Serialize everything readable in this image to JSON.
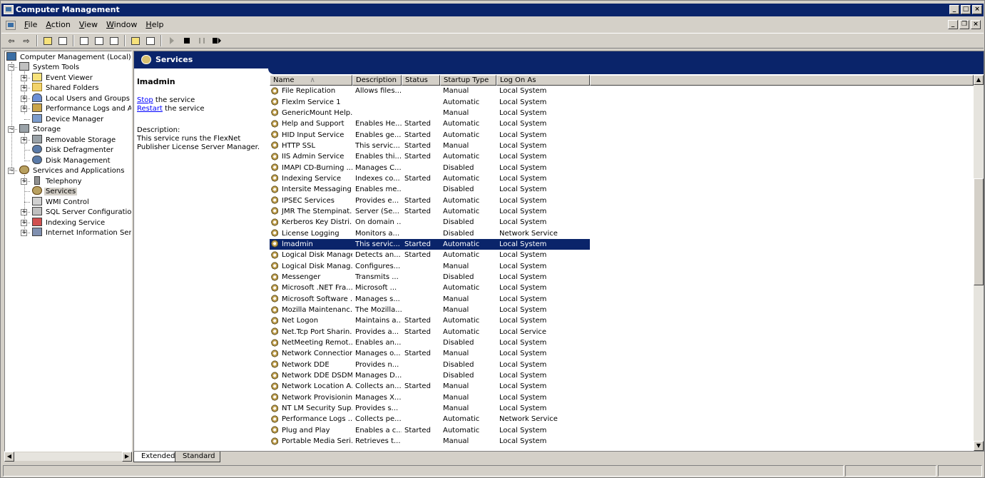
{
  "window": {
    "title": "Computer Management",
    "controls": [
      "_",
      "□",
      "×"
    ]
  },
  "menu": {
    "items": [
      {
        "label": "File",
        "key": "F",
        "rest": "ile"
      },
      {
        "label": "Action",
        "key": "A",
        "rest": "ction"
      },
      {
        "label": "View",
        "key": "V",
        "rest": "iew"
      },
      {
        "label": "Window",
        "key": "W",
        "rest": "indow"
      },
      {
        "label": "Help",
        "key": "H",
        "rest": "elp"
      }
    ],
    "mdi_controls": [
      "_",
      "❐",
      "×"
    ]
  },
  "toolbar": {
    "buttons": [
      "back-icon",
      "forward-icon",
      "up-folder-icon",
      "show-hide-tree-icon",
      "properties-icon",
      "refresh-icon",
      "export-list-icon",
      "help-icon",
      "show-hide-action-pane-icon",
      "start-service-icon",
      "stop-service-icon",
      "pause-service-icon",
      "restart-service-icon"
    ]
  },
  "tree": {
    "root": "Computer Management (Local)",
    "nodes": [
      {
        "label": "System Tools",
        "level": 1,
        "expander": "−",
        "icon": "tools"
      },
      {
        "label": "Event Viewer",
        "level": 2,
        "expander": "+",
        "icon": "event"
      },
      {
        "label": "Shared Folders",
        "level": 2,
        "expander": "+",
        "icon": "folder"
      },
      {
        "label": "Local Users and Groups",
        "level": 2,
        "expander": "+",
        "icon": "users"
      },
      {
        "label": "Performance Logs and Alerts",
        "level": 2,
        "expander": "+",
        "icon": "perf"
      },
      {
        "label": "Device Manager",
        "level": 2,
        "expander": "",
        "icon": "device"
      },
      {
        "label": "Storage",
        "level": 1,
        "expander": "−",
        "icon": "storage"
      },
      {
        "label": "Removable Storage",
        "level": 2,
        "expander": "+",
        "icon": "storage"
      },
      {
        "label": "Disk Defragmenter",
        "level": 2,
        "expander": "",
        "icon": "disk"
      },
      {
        "label": "Disk Management",
        "level": 2,
        "expander": "",
        "icon": "disk"
      },
      {
        "label": "Services and Applications",
        "level": 1,
        "expander": "−",
        "icon": "services"
      },
      {
        "label": "Telephony",
        "level": 2,
        "expander": "+",
        "icon": "phone"
      },
      {
        "label": "Services",
        "level": 2,
        "expander": "",
        "icon": "services",
        "selected": true
      },
      {
        "label": "WMI Control",
        "level": 2,
        "expander": "",
        "icon": "wmi"
      },
      {
        "label": "SQL Server Configuration Manager",
        "level": 2,
        "expander": "+",
        "icon": "sql"
      },
      {
        "label": "Indexing Service",
        "level": 2,
        "expander": "+",
        "icon": "index"
      },
      {
        "label": "Internet Information Services",
        "level": 2,
        "expander": "+",
        "icon": "iis"
      }
    ]
  },
  "pane": {
    "header": "Services",
    "selected_name": "lmadmin",
    "stop_link": "Stop",
    "stop_rest": " the service",
    "restart_link": "Restart",
    "restart_rest": " the service",
    "description_label": "Description:",
    "description_text": "This service runs the FlexNet Publisher License Server Manager."
  },
  "list": {
    "columns": [
      "Name",
      "Description",
      "Status",
      "Startup Type",
      "Log On As"
    ],
    "sort_indicator": "∧",
    "rows": [
      [
        "File Replication",
        "Allows files...",
        "",
        "Manual",
        "Local System"
      ],
      [
        "Flexlm Service 1",
        "",
        "",
        "Automatic",
        "Local System"
      ],
      [
        "GenericMount Help...",
        "",
        "",
        "Manual",
        "Local System"
      ],
      [
        "Help and Support",
        "Enables He...",
        "Started",
        "Automatic",
        "Local System"
      ],
      [
        "HID Input Service",
        "Enables ge...",
        "Started",
        "Automatic",
        "Local System"
      ],
      [
        "HTTP SSL",
        "This servic...",
        "Started",
        "Manual",
        "Local System"
      ],
      [
        "IIS Admin Service",
        "Enables thi...",
        "Started",
        "Automatic",
        "Local System"
      ],
      [
        "IMAPI CD-Burning ...",
        "Manages C...",
        "",
        "Disabled",
        "Local System"
      ],
      [
        "Indexing Service",
        "Indexes co...",
        "Started",
        "Automatic",
        "Local System"
      ],
      [
        "Intersite Messaging",
        "Enables me...",
        "",
        "Disabled",
        "Local System"
      ],
      [
        "IPSEC Services",
        "Provides e...",
        "Started",
        "Automatic",
        "Local System"
      ],
      [
        "JMR The Stempinat...",
        "Server (Se...",
        "Started",
        "Automatic",
        "Local System"
      ],
      [
        "Kerberos Key Distri...",
        "On domain ...",
        "",
        "Disabled",
        "Local System"
      ],
      [
        "License Logging",
        "Monitors a...",
        "",
        "Disabled",
        "Network Service"
      ],
      [
        "lmadmin",
        "This servic...",
        "Started",
        "Automatic",
        "Local System"
      ],
      [
        "Logical Disk Manager",
        "Detects an...",
        "Started",
        "Automatic",
        "Local System"
      ],
      [
        "Logical Disk Manag...",
        "Configures...",
        "",
        "Manual",
        "Local System"
      ],
      [
        "Messenger",
        "Transmits ...",
        "",
        "Disabled",
        "Local System"
      ],
      [
        "Microsoft .NET Fra...",
        "Microsoft ...",
        "",
        "Automatic",
        "Local System"
      ],
      [
        "Microsoft Software ...",
        "Manages s...",
        "",
        "Manual",
        "Local System"
      ],
      [
        "Mozilla Maintenanc...",
        "The Mozilla...",
        "",
        "Manual",
        "Local System"
      ],
      [
        "Net Logon",
        "Maintains a...",
        "Started",
        "Automatic",
        "Local System"
      ],
      [
        "Net.Tcp Port Sharin...",
        "Provides a...",
        "Started",
        "Automatic",
        "Local Service"
      ],
      [
        "NetMeeting Remot...",
        "Enables an...",
        "",
        "Disabled",
        "Local System"
      ],
      [
        "Network Connections",
        "Manages o...",
        "Started",
        "Manual",
        "Local System"
      ],
      [
        "Network DDE",
        "Provides n...",
        "",
        "Disabled",
        "Local System"
      ],
      [
        "Network DDE DSDM",
        "Manages D...",
        "",
        "Disabled",
        "Local System"
      ],
      [
        "Network Location A...",
        "Collects an...",
        "Started",
        "Manual",
        "Local System"
      ],
      [
        "Network Provisionin...",
        "Manages X...",
        "",
        "Manual",
        "Local System"
      ],
      [
        "NT LM Security Sup...",
        "Provides s...",
        "",
        "Manual",
        "Local System"
      ],
      [
        "Performance Logs ...",
        "Collects pe...",
        "",
        "Automatic",
        "Network Service"
      ],
      [
        "Plug and Play",
        "Enables a c...",
        "Started",
        "Automatic",
        "Local System"
      ],
      [
        "Portable Media Seri...",
        "Retrieves t...",
        "",
        "Manual",
        "Local System"
      ]
    ],
    "selected_index": 14
  },
  "tabs": [
    "Extended",
    "Standard"
  ]
}
